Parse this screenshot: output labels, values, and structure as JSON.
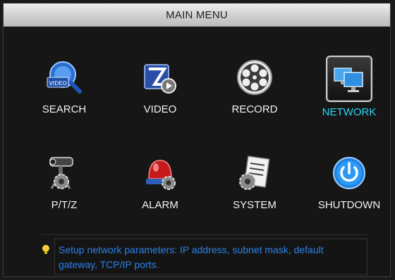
{
  "window": {
    "title": "MAIN MENU"
  },
  "menu": {
    "items": [
      {
        "label": "SEARCH",
        "icon": "search-icon",
        "selected": false
      },
      {
        "label": "VIDEO",
        "icon": "video-icon",
        "selected": false
      },
      {
        "label": "RECORD",
        "icon": "record-reel-icon",
        "selected": false
      },
      {
        "label": "NETWORK",
        "icon": "network-monitors-icon",
        "selected": true
      },
      {
        "label": "P/T/Z",
        "icon": "ptz-camera-gear-icon",
        "selected": false
      },
      {
        "label": "ALARM",
        "icon": "alarm-siren-gear-icon",
        "selected": false
      },
      {
        "label": "SYSTEM",
        "icon": "system-document-gear-icon",
        "selected": false
      },
      {
        "label": "SHUTDOWN",
        "icon": "power-icon",
        "selected": false
      }
    ]
  },
  "hint": {
    "icon": "lightbulb-icon",
    "text": "Setup network parameters: IP address, subnet mask, default gateway, TCP/IP ports."
  },
  "colors": {
    "selected_label": "#2ad6f6",
    "hint_text": "#2d82e6",
    "background": "#161616"
  }
}
